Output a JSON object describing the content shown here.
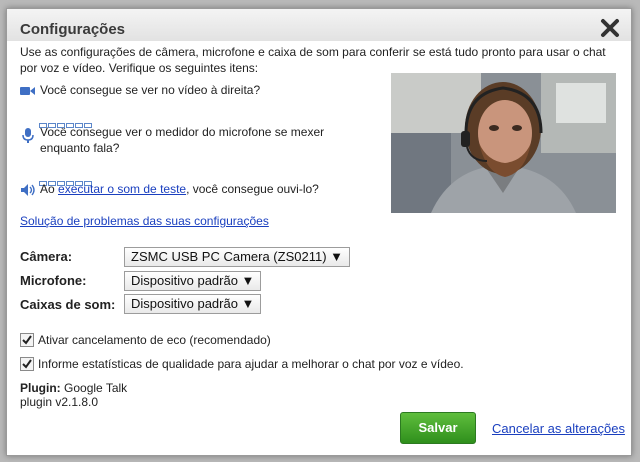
{
  "dialog": {
    "title": "Configurações",
    "intro": "Use as configurações de câmera, microfone e caixa de som para conferir se está tudo pronto para usar o chat por voz e vídeo. Verifique os seguintes itens:"
  },
  "checks": {
    "video_question": "Você consegue se ver no vídeo à direita?",
    "mic_question": "Você consegue ver o medidor do microfone se mexer enquanto fala?",
    "speaker_prefix": "Ao ",
    "speaker_link": "executar o som de teste",
    "speaker_suffix": ", você consegue ouvi-lo?"
  },
  "troubleshoot_link": "Solução de problemas das suas configurações",
  "devices": {
    "camera_label": "Câmera:",
    "camera_value": "ZSMC USB PC Camera (ZS0211) ▼",
    "mic_label": "Microfone:",
    "mic_value": "Dispositivo padrão ▼",
    "speaker_label": "Caixas de som:",
    "speaker_value": "Dispositivo padrão ▼"
  },
  "options": {
    "echo_label": "Ativar cancelamento de eco (recomendado)",
    "echo_checked": true,
    "stats_label": "Informe estatísticas de qualidade para ajudar a melhorar o chat por voz e vídeo.",
    "stats_checked": true
  },
  "plugin": {
    "label": "Plugin:",
    "name": "Google Talk",
    "version": "plugin v2.1.8.0"
  },
  "actions": {
    "save": "Salvar",
    "cancel": "Cancelar as alterações"
  },
  "colors": {
    "link": "#1a3fbf",
    "save_button": "#3fa327",
    "icon_blue": "#3f6fc4"
  }
}
